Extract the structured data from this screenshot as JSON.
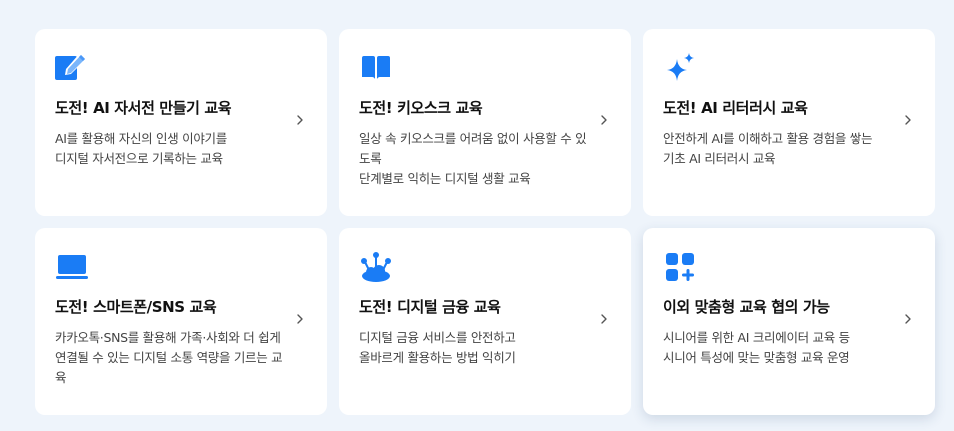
{
  "cards": [
    {
      "title": "도전! AI 자서전 만들기 교육",
      "desc": [
        "AI를 활용해 자신의 인생 이야기를",
        "디지털 자서전으로 기록하는 교육"
      ],
      "icon": "pencil-square-icon"
    },
    {
      "title": "도전! 키오스크 교육",
      "desc": [
        "일상 속 키오스크를 어려움 없이 사용할 수 있",
        "도록",
        "단계별로 익히는 디지털 생활 교육"
      ],
      "icon": "open-book-icon"
    },
    {
      "title": "도전! AI 리터러시 교육",
      "desc": [
        "안전하게 AI를 이해하고 활용 경험을 쌓는",
        "기초 AI 리터러시 교육"
      ],
      "icon": "sparkle-icon"
    },
    {
      "title": "도전! 스마트폰/SNS 교육",
      "desc": [
        "카카오톡·SNS를 활용해 가족·사회와 더 쉽게",
        "연결될 수 있는 디지털 소통 역량을 기르는 교",
        "육"
      ],
      "icon": "laptop-icon"
    },
    {
      "title": "도전! 디지털 금융 교육",
      "desc": [
        "디지털 금융 서비스를 안전하고",
        "올바르게 활용하는 방법 익히기"
      ],
      "icon": "cloud-network-icon"
    },
    {
      "title": "이외 맞춤형 교육 협의 가능",
      "desc": [
        "시니어를 위한 AI 크리에이터 교육 등",
        "시니어 특성에 맞는 맞춤형 교육 운영"
      ],
      "icon": "apps-plus-icon"
    }
  ],
  "colors": {
    "accent": "#1a7cf5",
    "background": "#eef4fb",
    "card": "#ffffff"
  }
}
